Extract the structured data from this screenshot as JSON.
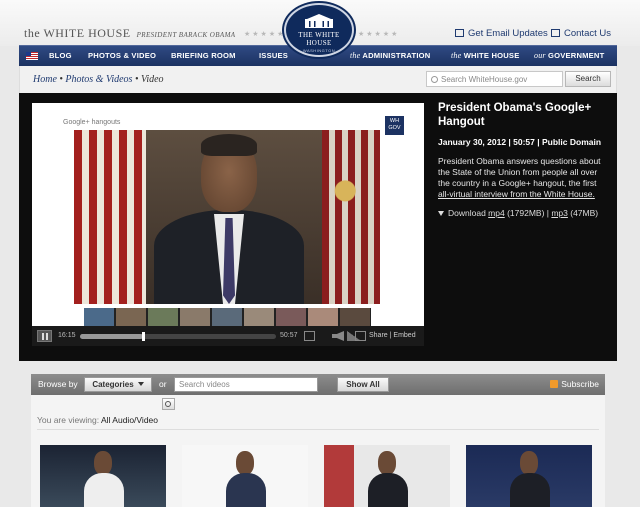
{
  "header": {
    "site_title": "the WHITE HOUSE",
    "site_subtitle": "PRESIDENT BARACK OBAMA",
    "seal_title": "THE WHITE HOUSE",
    "seal_sub": "WASHINGTON",
    "email_updates": "Get Email Updates",
    "contact_us": "Contact Us"
  },
  "nav": {
    "blog": "BLOG",
    "photos_video": "PHOTOS & VIDEO",
    "briefing_room": "BRIEFING ROOM",
    "issues": "ISSUES",
    "admin_prefix": "the",
    "admin": "ADMINISTRATION",
    "wh_prefix": "the",
    "wh": "WHITE HOUSE",
    "gov_prefix": "our",
    "gov": "GOVERNMENT"
  },
  "breadcrumb": {
    "home": "Home",
    "photos_videos": "Photos & Videos",
    "current": "Video",
    "sep": " • "
  },
  "search": {
    "placeholder": "Search WhiteHouse.gov",
    "button": "Search"
  },
  "player": {
    "hangout_label": "Google+ hangouts",
    "badge_line1": "WH",
    "badge_line2": "GOV",
    "time_elapsed": "16:15",
    "time_total": "50:57",
    "progress": 0.32,
    "share": "Share",
    "embed": "Embed",
    "ctrl_sep": " | "
  },
  "video": {
    "title": "President Obama's Google+ Hangout",
    "meta": "January 30, 2012  |  50:57  |  Public Domain",
    "desc_main": "President Obama answers questions about the State of the Union from people all over the country in a Google+ hangout, the first ",
    "desc_underlined": "all-virtual interview from the White House.",
    "download_label": "Download ",
    "mp4": "mp4",
    "mp4_size": " (1792MB) | ",
    "mp3": "mp3",
    "mp3_size": " (47MB)"
  },
  "browse": {
    "browse_by": "Browse by",
    "categories": "Categories",
    "or": "or",
    "search_placeholder": "Search videos",
    "show_all": "Show All",
    "subscribe": "Subscribe",
    "viewing_label": "You are viewing: ",
    "viewing_value": "All Audio/Video"
  },
  "colors": {
    "nav_blue": "#1c3262",
    "link_blue": "#1f3a70",
    "player_bg": "#0d0d0d",
    "rss_orange": "#f09a2c"
  }
}
